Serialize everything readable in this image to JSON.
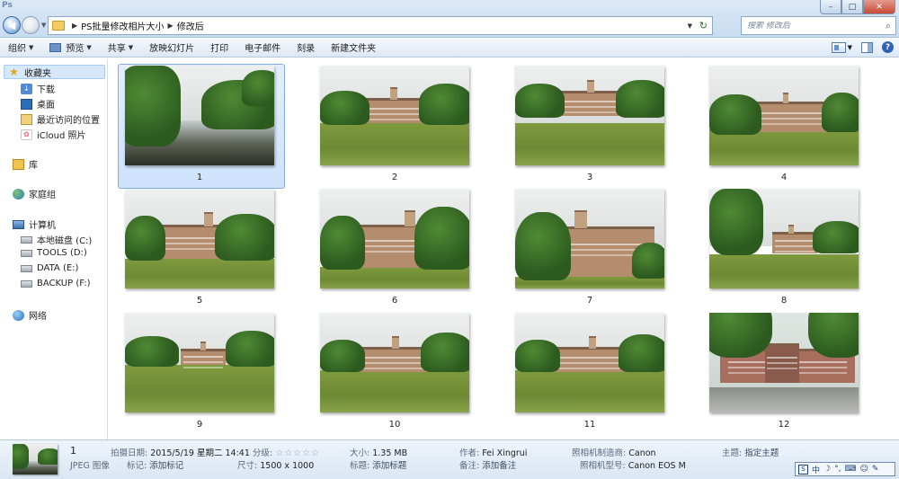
{
  "address": {
    "crumbs": [
      "PS批量修改相片大小",
      "修改后"
    ],
    "search_placeholder": "搜索 修改后"
  },
  "toolbar": {
    "organize": "组织",
    "preview": "预览",
    "share": "共享",
    "slideshow": "放映幻灯片",
    "print": "打印",
    "email": "电子邮件",
    "burn": "刻录",
    "new_folder": "新建文件夹"
  },
  "nav": {
    "favorites": "收藏夹",
    "downloads": "下载",
    "desktop": "桌面",
    "recent": "最近访问的位置",
    "icloud": "iCloud 照片",
    "libraries": "库",
    "homegroup": "家庭组",
    "computer": "计算机",
    "drive_c": "本地磁盘 (C:)",
    "drive_d": "TOOLS (D:)",
    "drive_e": "DATA (E:)",
    "drive_f": "BACKUP (F:)",
    "network": "网络"
  },
  "files": [
    {
      "label": "1"
    },
    {
      "label": "2"
    },
    {
      "label": "3"
    },
    {
      "label": "4"
    },
    {
      "label": "5"
    },
    {
      "label": "6"
    },
    {
      "label": "7"
    },
    {
      "label": "8"
    },
    {
      "label": "9"
    },
    {
      "label": "10"
    },
    {
      "label": "11"
    },
    {
      "label": "12"
    }
  ],
  "details": {
    "name": "1",
    "type": "JPEG 图像",
    "date_key": "拍摄日期:",
    "date_val": "2015/5/19 星期二 14:41",
    "rating_key": "分级:",
    "rating_stars": "☆☆☆☆☆",
    "tags_key": "标记:",
    "tags_val": "添加标记",
    "dims_key": "尺寸:",
    "dims_val": "1500 x 1000",
    "size_key": "大小:",
    "size_val": "1.35 MB",
    "title_key": "标题:",
    "title_val": "添加标题",
    "author_key": "作者:",
    "author_val": "Fei Xingrui",
    "comment_key": "备注:",
    "comment_val": "添加备注",
    "maker_key": "照相机制造商:",
    "maker_val": "Canon",
    "model_key": "照相机型号:",
    "model_val": "Canon EOS M",
    "subject_key": "主题:",
    "subject_val": "指定主题"
  },
  "ime": {
    "mode": "中"
  }
}
